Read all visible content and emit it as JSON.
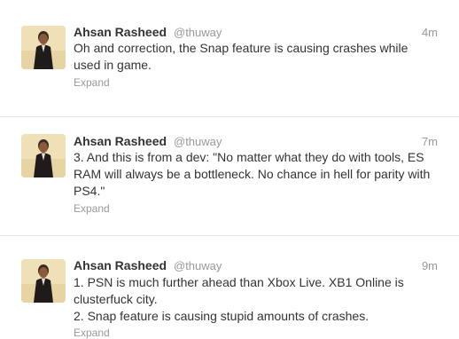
{
  "tweets": [
    {
      "name": "Ahsan Rasheed",
      "handle": "@thuway",
      "time": "4m",
      "text": "Oh and correction, the Snap feature is causing crashes while used in game.",
      "expand": "Expand"
    },
    {
      "name": "Ahsan Rasheed",
      "handle": "@thuway",
      "time": "7m",
      "text": "3. And this is from a dev: \"No matter what they do with tools, ES RAM will always be a bottleneck. No chance in hell for parity with PS4.\"",
      "expand": "Expand"
    },
    {
      "name": "Ahsan Rasheed",
      "handle": "@thuway",
      "time": "9m",
      "text": "1. PSN is much further ahead than Xbox Live.  XB1 Online is clusterfuck city.\n2. Snap feature is causing stupid amounts of crashes.",
      "expand": "Expand"
    }
  ]
}
